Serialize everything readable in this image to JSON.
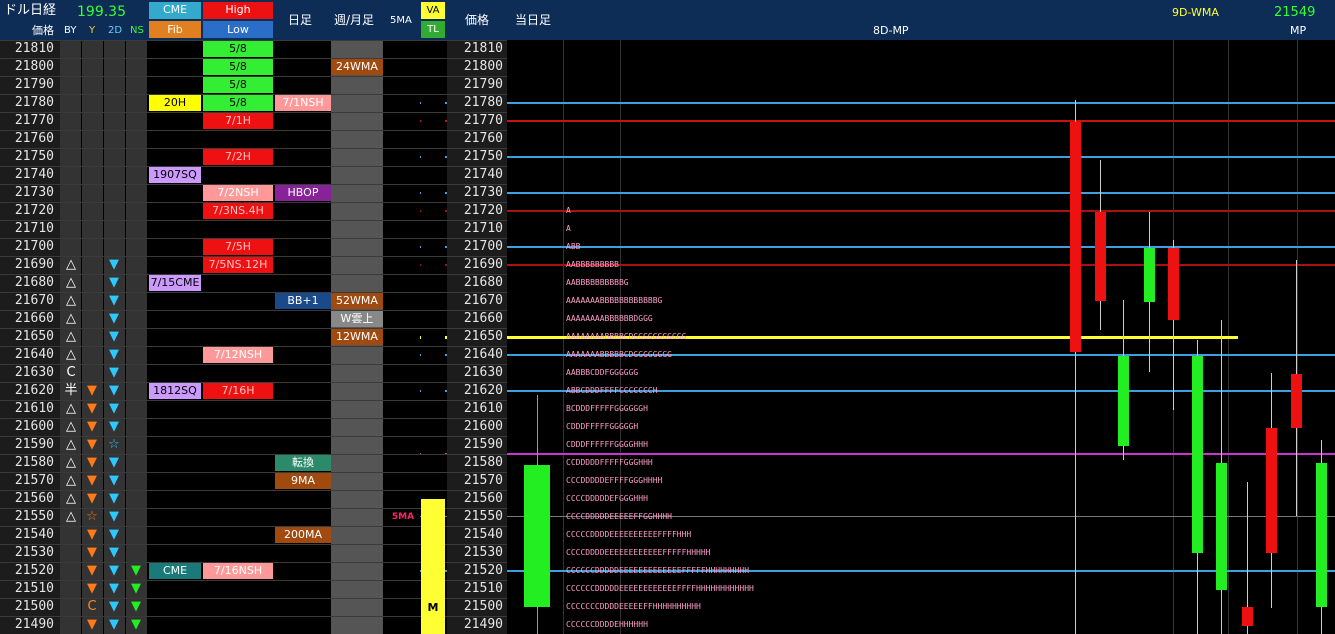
{
  "header": {
    "instrument": "ドル日経",
    "usd_value": "199.35",
    "price_label": "価格",
    "sub_cols": [
      "BY",
      "Y",
      "2D",
      "NS"
    ],
    "cme": "CME",
    "fib": "Fib",
    "high": "High",
    "low": "Low",
    "daily": "日足",
    "weekly_monthly": "週/月足",
    "ma5": "5MA",
    "va": "VA",
    "tl": "TL",
    "price_label2": "価格",
    "today": "当日足",
    "mp_title": "8D-MP",
    "wma_label": "9D-WMA",
    "wma_value": "21549",
    "mp_label": "MP"
  },
  "prices": [
    21810,
    21800,
    21790,
    21780,
    21770,
    21760,
    21750,
    21740,
    21730,
    21720,
    21710,
    21700,
    21690,
    21680,
    21670,
    21660,
    21650,
    21640,
    21630,
    21620,
    21610,
    21600,
    21590,
    21580,
    21570,
    21560,
    21550,
    21540,
    21530,
    21520,
    21510,
    21500,
    21490
  ],
  "col_by": [
    "",
    "",
    "",
    "",
    "",
    "",
    "",
    "",
    "",
    "",
    "",
    "",
    "△",
    "△",
    "△",
    "△",
    "△",
    "△",
    "C",
    "半",
    "△",
    "△",
    "△",
    "△",
    "△",
    "△",
    "△",
    "",
    "",
    "",
    "",
    "",
    ""
  ],
  "col_y": [
    "",
    "",
    "",
    "",
    "",
    "",
    "",
    "",
    "",
    "",
    "",
    "",
    "",
    "",
    "",
    "",
    "",
    "",
    "",
    "▼",
    "▼",
    "▼",
    "▼",
    "▼",
    "▼",
    "▼",
    "☆",
    "▼",
    "▼",
    "▼",
    "▼",
    "C",
    "▼"
  ],
  "col_2d": [
    "",
    "",
    "",
    "",
    "",
    "",
    "",
    "",
    "",
    "",
    "",
    "",
    "▼",
    "▼",
    "▼",
    "▼",
    "▼",
    "▼",
    "▼",
    "▼",
    "▼",
    "▼",
    "☆",
    "▼",
    "▼",
    "▼",
    "▼",
    "▼",
    "▼",
    "▼",
    "▼",
    "▼",
    "▼"
  ],
  "col_ns": [
    "",
    "",
    "",
    "",
    "",
    "",
    "",
    "",
    "",
    "",
    "",
    "",
    "",
    "",
    "",
    "",
    "",
    "",
    "",
    "",
    "",
    "",
    "",
    "",
    "",
    "",
    "",
    "",
    "",
    "▼",
    "▼",
    "▼",
    "▼"
  ],
  "labels": {
    "cme_20h": "20H",
    "cme_1907": "1907SQ",
    "cme_715": "7/15CME",
    "cme_1812": "1812SQ",
    "cme_cme": "CME",
    "hl_58a": "5/8",
    "hl_58b": "5/8",
    "hl_58c": "5/8",
    "hl_58d": "5/8",
    "hl_71h": "7/1H",
    "hl_72h": "7/2H",
    "hl_72nsh": "7/2NSH",
    "hl_73ns": "7/3NS.4H",
    "hl_75h": "7/5H",
    "hl_75ns": "7/5NS.12H",
    "hl_712": "7/12NSH",
    "hl_716h": "7/16H",
    "hl_716nsh": "7/16NSH",
    "d_71nsh": "7/1NSH",
    "d_hbop": "HBOP",
    "d_bb1": "BB+1",
    "d_tenkan": "転換",
    "d_9ma": "9MA",
    "d_200ma": "200MA",
    "w_24": "24WMA",
    "w_52": "52WMA",
    "w_kumo": "W雲上",
    "w_12": "12WMA",
    "ma5_val": "5MA",
    "va_m": "M"
  },
  "tpo_rows": {
    "21720": "A",
    "21710": "A",
    "21700": "ABB",
    "21690": "AABBBBBBBBB",
    "21680": "AABBBBBBBBBBG",
    "21670": "AAAAAAABBBBBBBBBBBBG",
    "21660": "AAAAAAAABBBBBBDGGG",
    "21650": "AAAAAAAABBBBCDGGGGGGGGGGG",
    "21640": "AAAAAAABBBBBCDGGGGGGGG",
    "21630": "AABBBCDDFGGGGGG",
    "21620": "ABBCDDDFFFFCCCCCCCH",
    "21610": "BCDDDFFFFFGGGGGGH",
    "21600": "CDDDFFFFFGGGGGH",
    "21590": "CDDDFFFFFFGGGGHHH",
    "21580": "CCDDDDDFFFFFGGGHHH",
    "21570": "CCCDDDDDEFFFFGGGHHHH",
    "21560": "CCCCDDDDDEFGGGHHH",
    "21550": "CCCCDDDDDEEEEEFFGGHHHH",
    "21540": "CCCCCDDDDEEEEEEEEEEFFFFHHH",
    "21530": "CCCCDDDDEEEEEEEEEEEEFFFFFHHHHH",
    "21520": "CCCCCCDDDDDEEEEEEEEEEEEEFFFFFHHHHHHHHH",
    "21510": "CCCCCCDDDDDEEEEEEEEEEEEFFFFHHHHHHHHHHHH",
    "21500": "CCCCCCCDDDDEEEEEFFHHHHHHHHHH",
    "21490": "CCCCCCDDDDEHHHHHH"
  },
  "colors": {
    "accent_green": "#33ff33",
    "red": "#ff1a1a",
    "blue_line": "#3ea0e0",
    "yellow_line": "#ffff33",
    "magenta_line": "#cc33cc"
  }
}
